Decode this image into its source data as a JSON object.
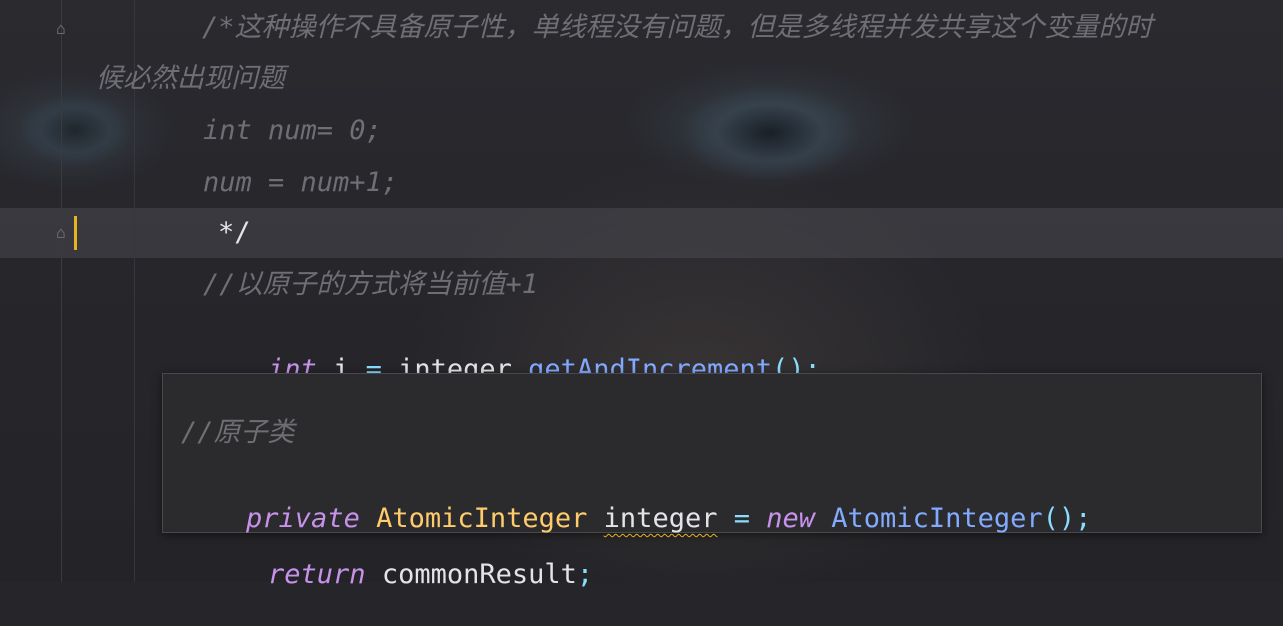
{
  "editor": {
    "comment_line1": "/*这种操作不具备原子性，单线程没有问题，但是多线程并发共享这个变量的时",
    "comment_line2": "候必然出现问题",
    "comment_line3": "int num= 0;",
    "comment_line4": "num = num+1;",
    "comment_close": "*/",
    "comment_line6": "//以原子的方式将当前值+1",
    "code_line7": {
      "kw": "int",
      "var": " i ",
      "op": "=",
      "obj": " integer",
      "dot": ".",
      "method": "getAndIncrement",
      "end": "();"
    },
    "code_line9": {
      "kw": "return",
      "rest": " commonResult",
      "semi": ";"
    }
  },
  "popup": {
    "comment": "//原子类",
    "decl": {
      "kw": "private",
      "type": " AtomicInteger ",
      "name": "integer",
      "op": " = ",
      "new_kw": "new",
      "cls": " AtomicInteger",
      "end": "();"
    }
  },
  "colors": {
    "caret": "#e6b422",
    "keyword": "#c792ea",
    "type": "#ffcb6b",
    "method": "#82aaff",
    "comment": "#6e6e74"
  }
}
